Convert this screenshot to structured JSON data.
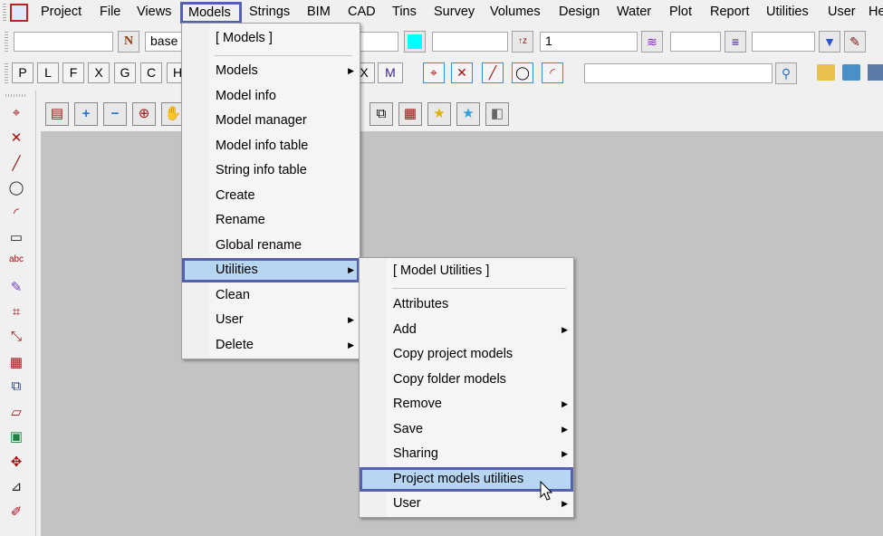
{
  "menubar": {
    "items": [
      "Project",
      "File",
      "Views",
      "Models",
      "Strings",
      "BIM",
      "CAD",
      "Tins",
      "Survey",
      "Volumes",
      "Design",
      "Water",
      "Plot",
      "Report",
      "Utilities",
      "User",
      "He"
    ]
  },
  "toolbar1": {
    "name_field": "",
    "n_button": "N",
    "model_field": "base",
    "colour": "#00ffff",
    "height_field": "1"
  },
  "toolbar2": {
    "filter_buttons": [
      "P",
      "L",
      "F",
      "X",
      "G",
      "C",
      "H",
      "X",
      "M"
    ],
    "search_value": ""
  },
  "models_menu": {
    "title": "[ Models ]",
    "items": [
      {
        "label": "Models",
        "submenu": true
      },
      {
        "label": "Model info"
      },
      {
        "label": "Model manager"
      },
      {
        "label": "Model info table"
      },
      {
        "label": "String info table"
      },
      {
        "label": "Create"
      },
      {
        "label": "Rename"
      },
      {
        "label": "Global rename"
      },
      {
        "label": "Utilities",
        "submenu": true,
        "highlighted": true
      },
      {
        "label": "Clean"
      },
      {
        "label": "User",
        "submenu": true
      },
      {
        "label": "Delete",
        "submenu": true
      }
    ]
  },
  "utilities_menu": {
    "title": "[ Model Utilities ]",
    "items": [
      {
        "label": "Attributes"
      },
      {
        "label": "Add",
        "submenu": true
      },
      {
        "label": "Copy project models"
      },
      {
        "label": "Copy folder models"
      },
      {
        "label": "Remove",
        "submenu": true
      },
      {
        "label": "Save",
        "submenu": true
      },
      {
        "label": "Sharing",
        "submenu": true
      },
      {
        "label": "Project models utilities",
        "highlighted": true
      },
      {
        "label": "User",
        "submenu": true
      }
    ]
  },
  "arrow": "▶"
}
